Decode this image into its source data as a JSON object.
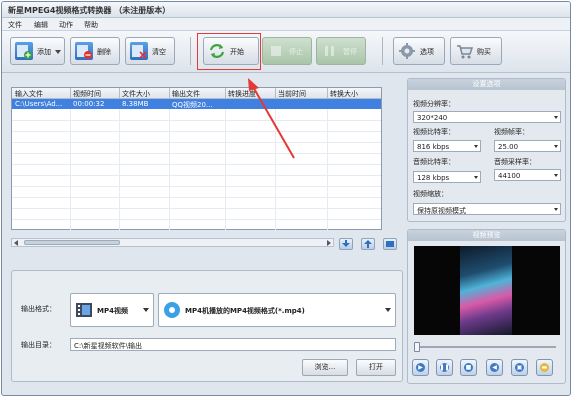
{
  "window": {
    "title": "新星MPEG4视频格式转换器 （未注册版本）"
  },
  "menu": [
    "文件",
    "编辑",
    "动作",
    "帮助"
  ],
  "toolbar": {
    "add": "添加",
    "delete": "删除",
    "clear": "清空",
    "start": "开始",
    "stop": "停止",
    "pause": "暂停",
    "options": "选项",
    "buy": "购买"
  },
  "table": {
    "headers": [
      "输入文件",
      "视频时间",
      "文件大小",
      "输出文件",
      "转换进度",
      "当前时间",
      "转换大小"
    ],
    "rows": [
      [
        "C:\\Users\\Ad...",
        "00:00:32",
        "8.38MB",
        "QQ视频20...",
        "",
        "",
        ""
      ]
    ]
  },
  "output": {
    "format_label": "输出格式：",
    "format_category": "MP4视频",
    "format_detail": "MP4机播放的MP4视频格式(*.mp4)",
    "dir_label": "输出目录：",
    "dir_value": "C:\\新星视频软件\\输出",
    "browse": "浏览...",
    "open": "打开"
  },
  "settings": {
    "header": "设置选项",
    "video_res_label": "视频分辨率：",
    "video_res_value": "320*240",
    "video_bitrate_label": "视频比特率：",
    "video_bitrate_value": "816 kbps",
    "frame_rate_label": "视频帧率：",
    "frame_rate_value": "25.00",
    "audio_bitrate_label": "音频比特率：",
    "audio_bitrate_value": "128 kbps",
    "sample_rate_label": "音频采样率：",
    "sample_rate_value": "44100",
    "zoom_label": "视频缩放：",
    "zoom_value": "保持原视频模式"
  },
  "preview": {
    "header": "视频预览",
    "position": 0
  },
  "colors": {
    "highlight": "#e53935",
    "selection": "#3f80e0"
  },
  "icons": [
    "add-icon",
    "delete-icon",
    "clear-icon",
    "refresh-icon",
    "stop-icon",
    "pause-icon",
    "settings-icon",
    "cart-icon",
    "play-icon",
    "pause-ctrl-icon",
    "stop-ctrl-icon",
    "volume-icon",
    "screenshot-icon",
    "folder-icon"
  ]
}
